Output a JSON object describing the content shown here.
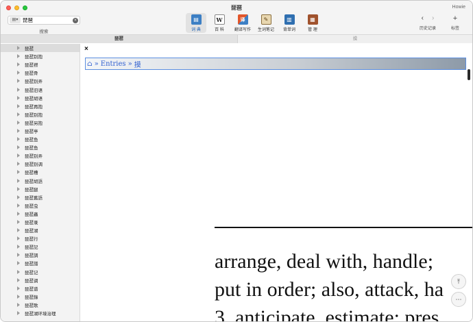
{
  "window": {
    "title": "琵琶",
    "user": "Howie"
  },
  "search": {
    "mode_label": "▤▾",
    "query": "琵琶",
    "caption": "搜索",
    "clear_glyph": "×"
  },
  "toolbar": {
    "tools": [
      {
        "name": "dictionary",
        "label": "词 典",
        "glyph": "▤",
        "color": "#3c7fc4",
        "active": true
      },
      {
        "name": "encyclopedia",
        "label": "百 科",
        "glyph": "W",
        "color": "#ffffff",
        "active": false
      },
      {
        "name": "translate-write",
        "label": "翻译写作",
        "glyph": "译",
        "color": "#e2562b",
        "active": false
      },
      {
        "name": "vocab-notes",
        "label": "生词笔记",
        "glyph": "✎",
        "color": "#c9a86a",
        "active": false
      },
      {
        "name": "recite",
        "label": "背单词",
        "glyph": "▥",
        "color": "#2f6fb0",
        "active": false
      },
      {
        "name": "manage",
        "label": "管 理",
        "glyph": "▦",
        "color": "#a0522d",
        "active": false
      }
    ],
    "history_label": "历史记录",
    "bookmark_label": "标签",
    "back_glyph": "‹",
    "forward_glyph": "›",
    "add_glyph": "+"
  },
  "tabs": {
    "left": "琵琶",
    "right": "摸"
  },
  "sidebar": {
    "items": [
      "琵琶",
      "琵琶别抱",
      "琵琶襟",
      "琵琶骨",
      "琵琶别弄",
      "琵琶旧语",
      "琵琶胡语",
      "琵琶再抱",
      "琵琶别抱",
      "琵琶另抱",
      "琵琶亭",
      "琵琶鱼",
      "琵琶鱼",
      "琵琶别弄",
      "琵琶别调",
      "琵琶槽",
      "琵琶胡語",
      "琵琶腿",
      "琵琶舊語",
      "琵琶虫",
      "琵琶蟲",
      "琵琶录",
      "琵琶湖",
      "琵琶行",
      "琵琶記",
      "琵琶調",
      "琵琶譜",
      "琵琶记",
      "琵琶调",
      "琵琶谱",
      "琵琶錄",
      "琵琶歌",
      "琵琶湖环境治理"
    ],
    "selected_index": 0
  },
  "content": {
    "close_glyph": "×",
    "breadcrumb": {
      "home_glyph": "⌂",
      "sep": "»",
      "entries": "Entries",
      "current": "摸"
    },
    "definition_lines": [
      "arrange, deal with, handle;",
      "put in order; also, attack, ha",
      "3. anticipate, estimate; pres"
    ],
    "scroll_top_glyph": "⤒",
    "more_glyph": "⋯"
  }
}
